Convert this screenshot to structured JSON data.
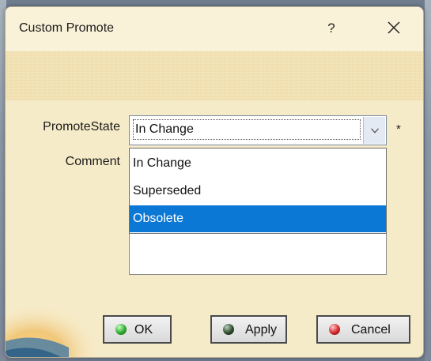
{
  "dialog": {
    "title": "Custom Promote",
    "help_label": "?",
    "close_icon": "close-icon"
  },
  "form": {
    "promote_state_label": "PromoteState",
    "comment_label": "Comment",
    "selected_value": "In Change",
    "required_marker": "*",
    "options": [
      "In Change",
      "Superseded",
      "Obsolete"
    ],
    "highlighted_option": "Obsolete",
    "comment_value": ""
  },
  "buttons": {
    "ok_label": "OK",
    "apply_label": "Apply",
    "cancel_label": "Cancel"
  },
  "colors": {
    "dialog_bg": "#f6ebc8",
    "highlight": "#0b78d6",
    "ok_dot": "#2eab2e",
    "apply_dot": "#2f4a2f",
    "cancel_dot": "#d22a2a"
  }
}
